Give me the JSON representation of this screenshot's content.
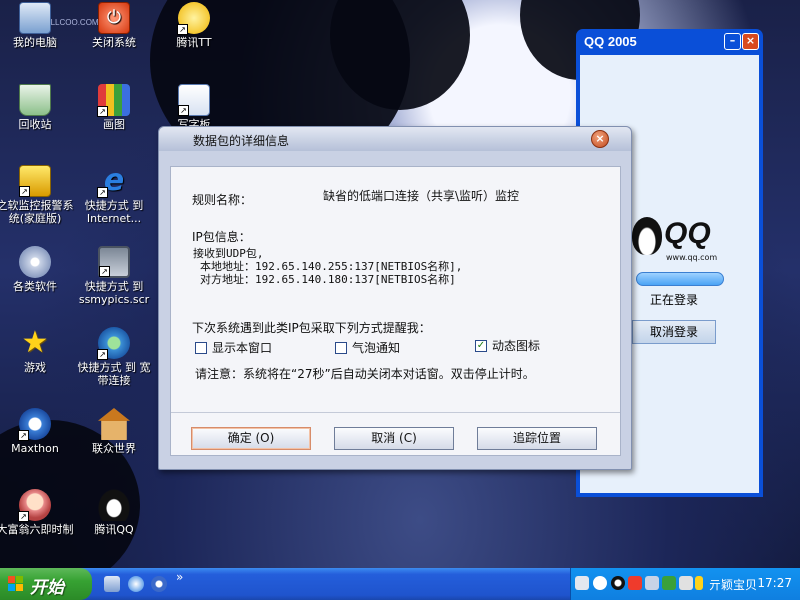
{
  "desktop": {
    "icons": [
      {
        "label": "我的电脑"
      },
      {
        "label": "关闭系统"
      },
      {
        "label": "腾讯TT"
      },
      {
        "label": "回收站"
      },
      {
        "label": "画图"
      },
      {
        "label": "写字板"
      },
      {
        "label": "之软监控报警系统(家庭版)"
      },
      {
        "label": "快捷方式 到 Internet..."
      },
      {
        "label": "各类软件"
      },
      {
        "label": "快捷方式 到 ssmypics.scr"
      },
      {
        "label": "游戏"
      },
      {
        "label": "快捷方式 到 宽带连接"
      },
      {
        "label": "Maxthon"
      },
      {
        "label": "联众世界"
      },
      {
        "label": "大富翁六即时制"
      },
      {
        "label": "腾讯QQ"
      }
    ],
    "watermark": "WALLCOO.COM"
  },
  "qq_window": {
    "title": "QQ 2005",
    "minimize": "–",
    "close": "×",
    "logo_text": "QQ",
    "logo_url": "www.qq.com",
    "status": "正在登录",
    "cancel_label": "取消登录"
  },
  "dialog": {
    "title": "数据包的详细信息",
    "close": "×",
    "rule_label": "规则名称：",
    "rule_value": "缺省的低端口连接（共享\\监听）监控",
    "ip_label": "IP包信息：",
    "ip_line1": "接收到UDP包,",
    "ip_line2": "本地地址：192.65.140.255:137[NETBIOS名称],",
    "ip_line3": "对方地址：192.65.140.180:137[NETBIOS名称]",
    "next_label": "下次系统遇到此类IP包采取下列方式提醒我：",
    "opt_window": "显示本窗口",
    "opt_bubble": "气泡通知",
    "opt_icon": "动态图标",
    "opt_icon_checked": "✓",
    "notice": "请注意：系统将在“27秒”后自动关闭本对话窗。双击停止计时。",
    "ok_label": "确定 (O)",
    "cancel_label": "取消 (C)",
    "trace_label": "追踪位置"
  },
  "taskbar": {
    "start_label": "开始",
    "more": "»",
    "tray_text": "亓颖宝贝",
    "clock": "17:27"
  }
}
